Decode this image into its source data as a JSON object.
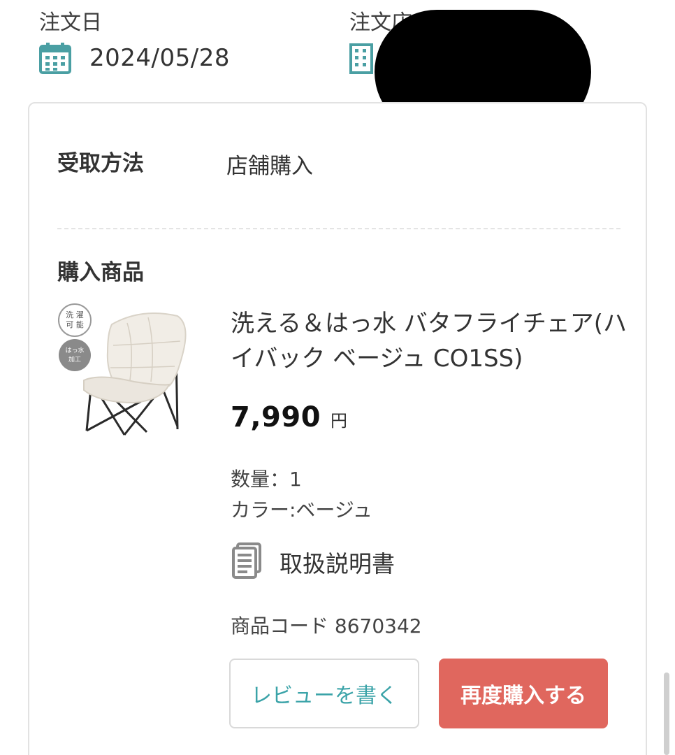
{
  "order_meta": {
    "date_label": "注文日",
    "date_value": "2024/05/28",
    "store_label_visible": "注文店"
  },
  "receive": {
    "label": "受取方法",
    "value": "店舗購入"
  },
  "purchase": {
    "section_label": "購入商品",
    "badges": {
      "washable": "洗濯可能",
      "water_repellent": "はっ水加工"
    },
    "product_name": "洗える＆はっ水 バタフライチェア(ハイバック ベージュ CO1SS)",
    "price": "7,990",
    "currency": "円",
    "quantity_text": "数量：1",
    "color_text": "カラー:ベージュ",
    "manual_label": "取扱説明書",
    "product_code_text": "商品コード 8670342"
  },
  "buttons": {
    "review": "レビューを書く",
    "rebuy": "再度購入する"
  },
  "colors": {
    "accent_teal": "#3aa3a8",
    "rebuy_red": "#e0675e",
    "icon_teal": "#4a9fa3"
  }
}
